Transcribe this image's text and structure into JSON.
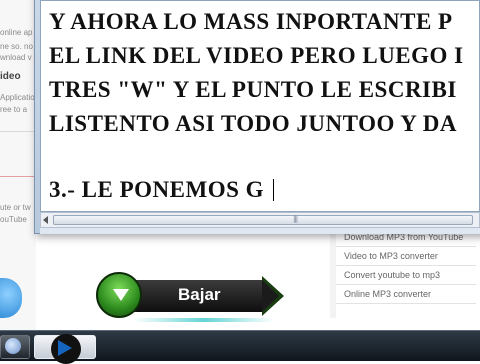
{
  "background_page": {
    "left_fragments": [
      "online ap",
      "ne so. no",
      "wnload v",
      "ideo",
      "Applicatio",
      "ree to a",
      "ute or tw",
      "ouTube"
    ],
    "side_links": [
      "Download MP3 from YouTube",
      "Video to MP3 converter",
      "Convert youtube to mp3",
      "Online MP3 converter"
    ],
    "download_button": {
      "label": "Bajar",
      "icon": "down-arrow-icon",
      "accent_color": "#2c8a1d"
    }
  },
  "notepad": {
    "lines": [
      "Y AHORA LO MASS INPORTANTE P",
      "EL LINK DEL VIDEO PERO LUEGO I",
      "TRES \"W\" Y EL PUNTO LE ESCRIBI",
      "LISTENTO ASI TODO JUNTOO Y DA",
      "",
      "3.- LE PONEMOS G"
    ],
    "scrollbar_grip": "|||"
  },
  "taskbar": {
    "items": [
      "taskbar-item",
      "taskbar-item-active"
    ]
  }
}
